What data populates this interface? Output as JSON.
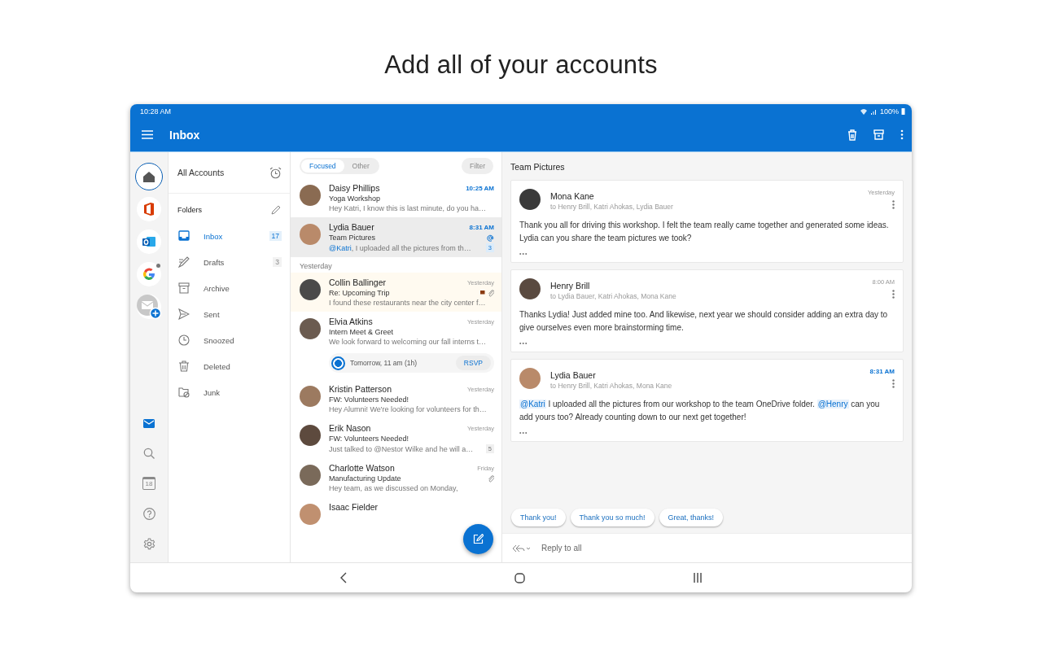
{
  "headline": "Add all of your accounts",
  "status_bar": {
    "time": "10:28 AM",
    "battery": "100%"
  },
  "app_bar": {
    "title": "Inbox"
  },
  "account_rail": {
    "accounts": [
      {
        "kind": "home",
        "selected": true
      },
      {
        "kind": "office",
        "selected": false
      },
      {
        "kind": "outlook",
        "selected": false
      },
      {
        "kind": "google",
        "selected": false
      },
      {
        "kind": "add",
        "selected": false
      }
    ],
    "tools": [
      {
        "kind": "mail",
        "selected": true
      },
      {
        "kind": "search",
        "selected": false
      },
      {
        "kind": "calendar",
        "selected": false,
        "day": "18"
      },
      {
        "kind": "help",
        "selected": false
      },
      {
        "kind": "settings",
        "selected": false
      }
    ]
  },
  "folder_pane": {
    "account_label": "All Accounts",
    "heading": "Folders",
    "folders": [
      {
        "kind": "inbox",
        "name": "Inbox",
        "count": "17",
        "selected": true
      },
      {
        "kind": "drafts",
        "name": "Drafts",
        "count": "3",
        "selected": false
      },
      {
        "kind": "archive",
        "name": "Archive",
        "selected": false
      },
      {
        "kind": "sent",
        "name": "Sent",
        "selected": false
      },
      {
        "kind": "snoozed",
        "name": "Snoozed",
        "selected": false
      },
      {
        "kind": "deleted",
        "name": "Deleted",
        "selected": false
      },
      {
        "kind": "junk",
        "name": "Junk",
        "selected": false
      }
    ]
  },
  "message_list": {
    "tabs": [
      {
        "label": "Focused",
        "selected": true
      },
      {
        "label": "Other",
        "selected": false
      }
    ],
    "filter": "Filter",
    "items": [
      {
        "kind": "message",
        "sender": "Daisy Phillips",
        "time": "10:25 AM",
        "subject": "Yoga Workshop",
        "preview": "Hey Katri, I know this is last minute, do you ha…",
        "unread": true,
        "selected": false,
        "flagged": false
      },
      {
        "kind": "message",
        "sender": "Lydia Bauer",
        "time": "8:31 AM",
        "subject": "Team Pictures",
        "mention": "@Katri",
        "preview": ", I uploaded all the pictures from th…",
        "count": "3",
        "mentioned": true,
        "unread": true,
        "selected": true,
        "flagged": false
      },
      {
        "kind": "section",
        "label": "Yesterday"
      },
      {
        "kind": "message",
        "sender": "Collin Ballinger",
        "time": "Yesterday",
        "subject": "Re: Upcoming Trip",
        "preview": "I found these restaurants near the city center f…",
        "unread": false,
        "selected": false,
        "flagged": true,
        "attachment": true
      },
      {
        "kind": "message",
        "sender": "Elvia Atkins",
        "time": "Yesterday",
        "subject": "Intern Meet & Greet",
        "preview": "We look forward to welcoming our fall interns t…",
        "unread": false,
        "selected": false,
        "flagged": false,
        "event": {
          "time": "Tomorrow, 11 am (1h)",
          "action": "RSVP"
        }
      },
      {
        "kind": "message",
        "sender": "Kristin Patterson",
        "time": "Yesterday",
        "subject": "FW: Volunteers Needed!",
        "preview": "Hey Alumni! We're looking for volunteers for th…",
        "unread": false,
        "selected": false,
        "flagged": false
      },
      {
        "kind": "message",
        "sender": "Erik Nason",
        "time": "Yesterday",
        "subject": "FW: Volunteers Needed!",
        "preview": "Just talked to @Nestor Wilke and he will a…",
        "count": "5",
        "unread": false,
        "selected": false,
        "flagged": false
      },
      {
        "kind": "message",
        "sender": "Charlotte Watson",
        "time": "Friday",
        "subject": "Manufacturing Update",
        "preview": "Hey team, as we discussed on Monday,",
        "unread": false,
        "selected": false,
        "flagged": false,
        "attachment": true
      },
      {
        "kind": "message",
        "sender": "Isaac Fielder",
        "selected": false,
        "flagged": false
      }
    ]
  },
  "reading_pane": {
    "subject": "Team Pictures",
    "messages": [
      {
        "sender": "Mona Kane",
        "recipients": "to Henry Brill, Katri Ahokas, Lydia Bauer",
        "time": "Yesterday",
        "unread": false,
        "body": [
          {
            "kind": "text",
            "text": "Thank you all for driving this workshop. I felt the team really came together and generated some ideas. Lydia can you share the team pictures we took?"
          }
        ],
        "more": "•••"
      },
      {
        "sender": "Henry Brill",
        "recipients": "to Lydia Bauer, Katri Ahokas, Mona Kane",
        "time": "8:00 AM",
        "unread": false,
        "body": [
          {
            "kind": "text",
            "text": "Thanks Lydia! Just added mine too. And likewise, next year we should consider adding an extra day to give ourselves even more brainstorming time."
          }
        ],
        "more": "•••"
      },
      {
        "sender": "Lydia Bauer",
        "recipients": "to Henry Brill, Katri Ahokas, Mona Kane",
        "time": "8:31 AM",
        "unread": true,
        "body": [
          {
            "kind": "mention",
            "text": "@Katri"
          },
          {
            "kind": "text",
            "text": " I uploaded all the pictures from our workshop to the team OneDrive folder. "
          },
          {
            "kind": "mention",
            "text": "@Henry"
          },
          {
            "kind": "text",
            "text": " can you add yours too? Already counting down to our next get together!"
          }
        ],
        "more": "•••"
      }
    ],
    "quick_replies": [
      "Thank you!",
      "Thank you so much!",
      "Great, thanks!"
    ],
    "reply": "Reply to all"
  }
}
